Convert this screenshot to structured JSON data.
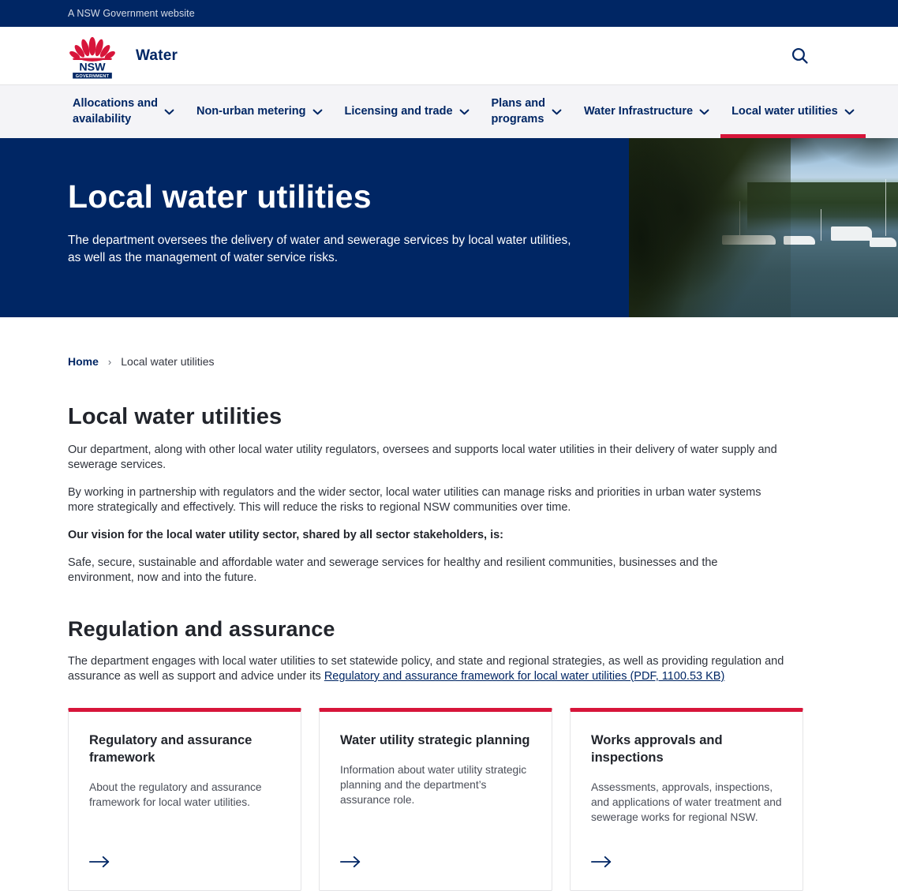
{
  "topbar": {
    "text": "A NSW Government website"
  },
  "masthead": {
    "logo_alt": "NSW Government",
    "logo_line1": "NSW",
    "logo_line2": "GOVERNMENT",
    "site_title": "Water",
    "search_icon": "search-icon",
    "colors": {
      "navy": "#002664",
      "red": "#d7153a"
    }
  },
  "nav": {
    "items": [
      {
        "label": "Allocations and\navailability",
        "active": false,
        "chevron": "chevron-down-icon"
      },
      {
        "label": "Non-urban metering",
        "active": false,
        "chevron": "chevron-down-icon"
      },
      {
        "label": "Licensing and trade",
        "active": false,
        "chevron": "chevron-down-icon"
      },
      {
        "label": "Plans and\nprograms",
        "active": false,
        "chevron": "chevron-down-icon"
      },
      {
        "label": "Water Infrastructure",
        "active": false,
        "chevron": "chevron-down-icon"
      },
      {
        "label": "Local water utilities",
        "active": true,
        "chevron": "chevron-down-icon"
      }
    ]
  },
  "hero": {
    "title": "Local water utilities",
    "subtitle": "The department oversees the delivery of water and sewerage services by local water utilities, as well as the management of water service risks.",
    "image_alt": "River with moored boats and dense foliage"
  },
  "breadcrumb": {
    "home": "Home",
    "separator": "›",
    "current": "Local water utilities"
  },
  "main": {
    "page_title": "Local water utilities",
    "paragraphs": [
      "Our department, along with other local water utility regulators, oversees and supports local water utilities in their delivery of water supply and sewerage services.",
      "By working in partnership with regulators and the wider sector, local water utilities can manage risks and priorities in urban water systems more strategically and effectively. This will reduce the risks to regional NSW communities over time."
    ],
    "vision_heading": "Our vision for the local water utility sector, shared by all sector stakeholders, is:",
    "vision_text": "Safe, secure, sustainable and affordable water and sewerage services for healthy and resilient communities, businesses and the environment, now and into the future.",
    "section_title": "Regulation and assurance",
    "section_intro_before": "The department engages with local water utilities to set statewide policy, and state and regional strategies, as well as providing regulation and assurance as well as support and advice under its ",
    "section_link": "Regulatory and assurance framework for local water utilities (PDF, 1100.53 KB)"
  },
  "cards": [
    {
      "title": "Regulatory and assurance framework",
      "desc": "About the regulatory and assurance framework for local water utilities.",
      "arrow": "arrow-right-icon"
    },
    {
      "title": "Water utility strategic planning",
      "desc": "Information about water utility strategic planning and the department’s assurance role.",
      "arrow": "arrow-right-icon"
    },
    {
      "title": "Works approvals and inspections",
      "desc": "Assessments, approvals, inspections, and applications of water treatment and sewerage works for regional NSW.",
      "arrow": "arrow-right-icon"
    }
  ]
}
